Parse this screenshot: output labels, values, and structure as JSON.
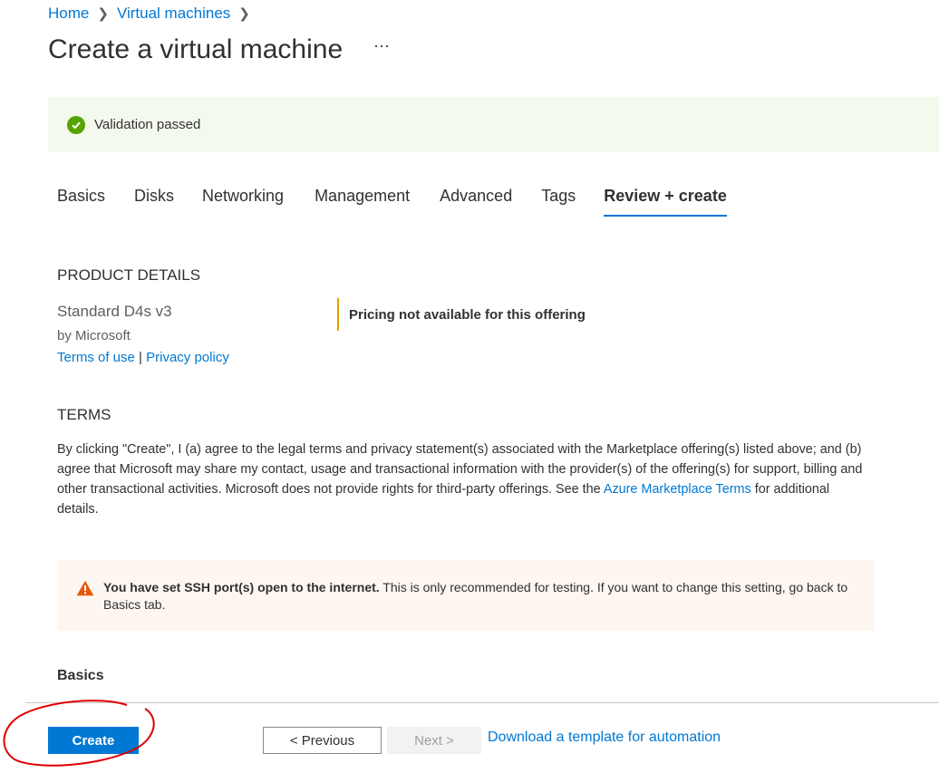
{
  "breadcrumb": {
    "items": [
      "Home",
      "Virtual machines"
    ]
  },
  "page": {
    "title": "Create a virtual machine",
    "more_label": "···"
  },
  "validation": {
    "message": "Validation passed",
    "icon": "check-circle-icon",
    "color": "#57a300"
  },
  "tabs": [
    {
      "label": "Basics"
    },
    {
      "label": "Disks"
    },
    {
      "label": "Networking"
    },
    {
      "label": "Management"
    },
    {
      "label": "Advanced"
    },
    {
      "label": "Tags"
    },
    {
      "label": "Review + create",
      "active": true
    }
  ],
  "product": {
    "heading": "PRODUCT DETAILS",
    "name": "Standard D4s v3",
    "by": "by Microsoft",
    "terms_of_use": "Terms of use",
    "separator": "|",
    "privacy_policy": "Privacy policy",
    "pricing": "Pricing not available for this offering"
  },
  "terms": {
    "heading": "TERMS",
    "text_before_link": "By clicking \"Create\", I (a) agree to the legal terms and privacy statement(s) associated with the Marketplace offering(s) listed above; and (b) agree that Microsoft may share my contact, usage and transactional information with the provider(s) of the offering(s) for support, billing and other transactional activities. Microsoft does not provide rights for third-party offerings. See the ",
    "link": "Azure Marketplace Terms",
    "text_after_link": " for additional details."
  },
  "warning": {
    "icon": "warning-icon",
    "bold": "You have set SSH port(s) open to the internet.",
    "text": " This is only recommended for testing.  If you want to change this setting, go back to Basics tab."
  },
  "basics_heading": "Basics",
  "footer": {
    "create": "Create",
    "previous": "< Previous",
    "next": "Next >",
    "download": "Download a template for automation"
  },
  "colors": {
    "accent": "#0078d4",
    "warning": "#e0a000",
    "annotation": "#e00000"
  }
}
